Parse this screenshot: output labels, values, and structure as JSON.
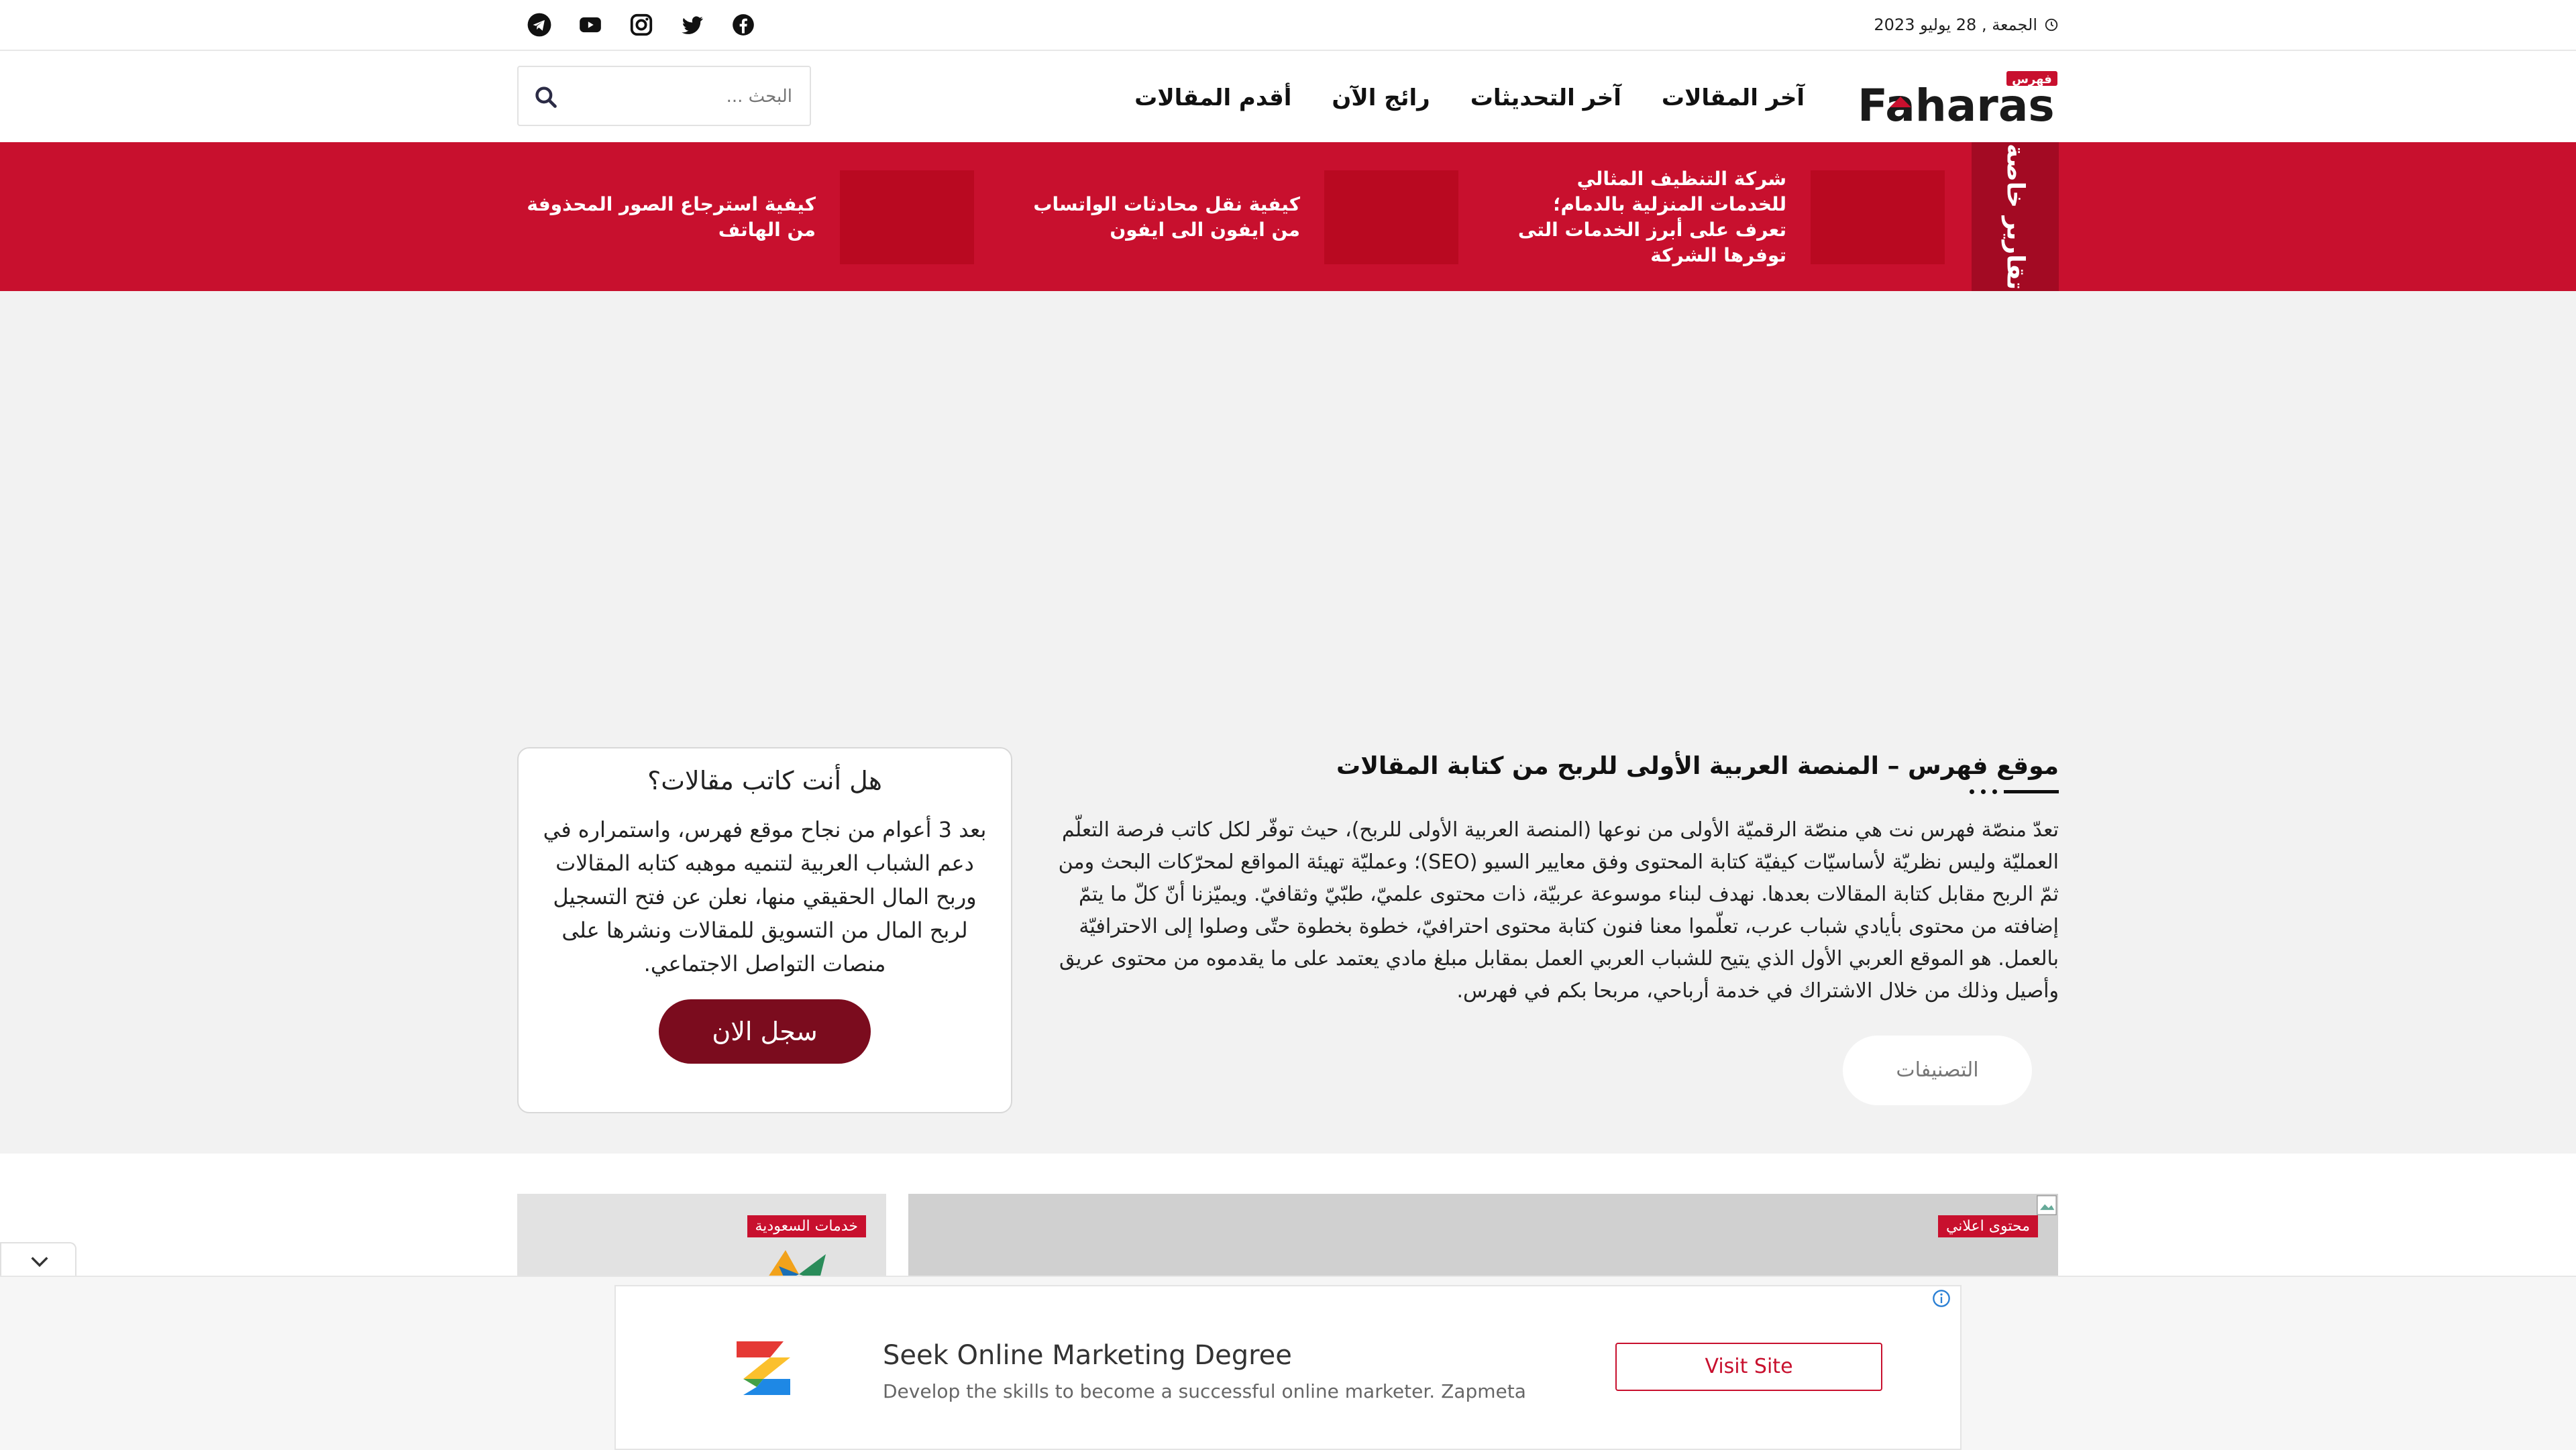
{
  "topbar": {
    "date": "الجمعة , 28 يوليو 2023",
    "social": [
      "telegram-icon",
      "youtube-icon",
      "instagram-icon",
      "twitter-icon",
      "facebook-icon"
    ]
  },
  "header": {
    "logo_text": "Faharas",
    "logo_badge": "فهرس",
    "nav": [
      "آخر المقالات",
      "آخر التحديثات",
      "رائج الآن",
      "أقدم المقالات"
    ],
    "search_placeholder": "البحث ..."
  },
  "special": {
    "label": "تقارير خاصة",
    "items": [
      "شركة التنظيف المثالي للخدمات المنزلية بالدمام؛ تعرف على أبرز الخدمات التى توفرها الشركة",
      "كيفية نقل محادثات الواتساب من ايفون الى ايفون",
      "كيفية استرجاع الصور المحذوفة من الهاتف"
    ]
  },
  "writer_card": {
    "title": "هل أنت كاتب مقالات؟",
    "text": "بعد 3 أعوام من نجاح موقع فهرس، واستمراره في دعم الشباب العربية لتنميه موهبه كتابه المقالات وربح المال الحقيقي منها، نعلن عن فتح التسجيل لربح المال من التسويق للمقالات ونشرها على منصات التواصل الاجتماعي.",
    "button": "سجل الان"
  },
  "about": {
    "title": "موقع فهرس – المنصة العربية الأولى للربح من كتابة المقالات",
    "text": "تعدّ منصّة فهرس نت هي منصّة الرقميّة الأولى من نوعها (المنصة العربية الأولى للربح)، حيث توفّر لكل كاتب فرصة التعلّم العمليّة وليس نظريّة لأساسيّات كيفيّة كتابة المحتوى وفق معايير السيو (SEO)؛ وعمليّة تهيئة المواقع لمحرّكات البحث ومن ثمّ الربح مقابل كتابة المقالات بعدها. نهدف لبناء موسوعة عربيّة، ذات محتوى علميّ، طبّيّ وثقافيّ. ويميّزنا أنّ كلّ ما يتمّ إضافته من محتوى بأيادي شباب عرب، تعلّموا معنا فنون كتابة محتوى احترافيّ، خطوة بخطوة حتّى وصلوا إلى الاحترافيّة بالعمل. هو الموقع العربي الأول الذي يتيح للشباب العربي العمل بمقابل مبلغ مادي يعتمد على ما يقدموه من محتوى عريق وأصيل وذلك من خلال الاشتراك في خدمة أرباحي، مربحا بكم في فهرس.",
    "categories_button": "التصنيفات"
  },
  "posts": {
    "big_tag": "محتوى اعلاني",
    "small_tag": "خدمات السعودية"
  },
  "ad": {
    "title": "Seek Online Marketing Degree",
    "subtitle": "Develop the skills to become a successful online marketer. Zapmeta",
    "button": "Visit Site"
  },
  "colors": {
    "brand_red": "#c8102e",
    "dark_red": "#7b0c1e"
  }
}
